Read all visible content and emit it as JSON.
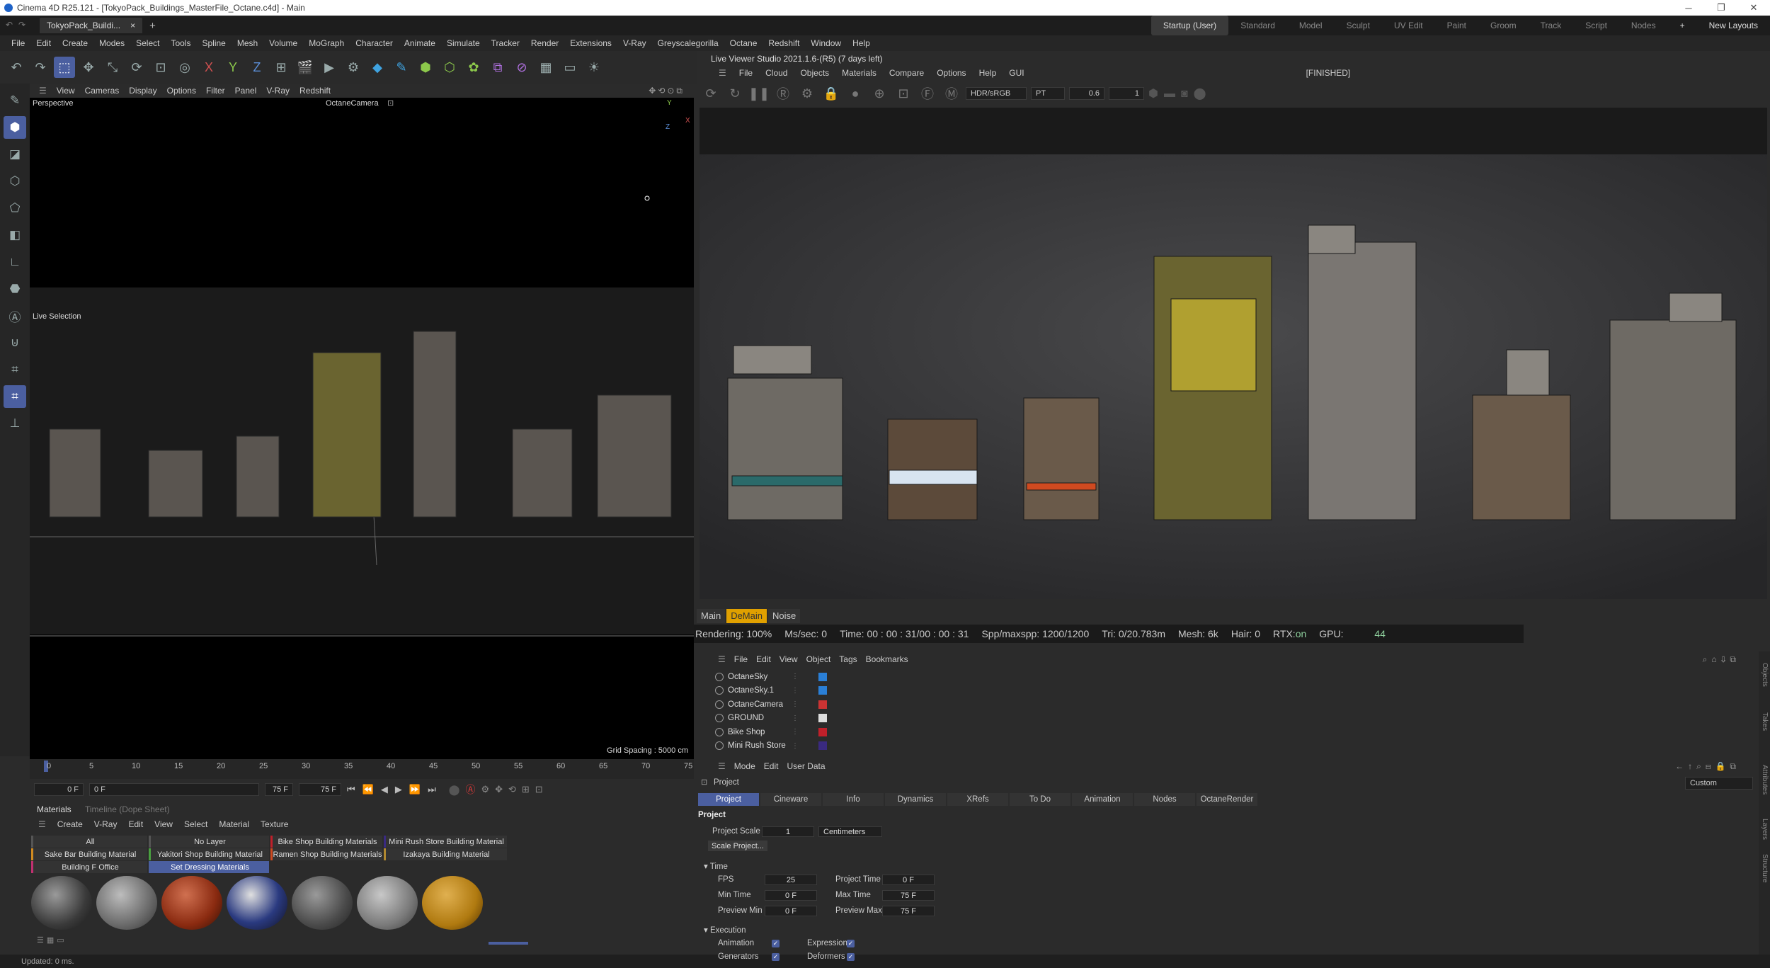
{
  "window": {
    "title": "Cinema 4D R25.121 - [TokyoPack_Buildings_MasterFile_Octane.c4d] - Main",
    "doc_tab": "TokyoPack_Buildi...",
    "close": "×",
    "add": "+"
  },
  "layouts": {
    "items": [
      "Startup (User)",
      "Standard",
      "Model",
      "Sculpt",
      "UV Edit",
      "Paint",
      "Groom",
      "Track",
      "Script",
      "Nodes"
    ],
    "add": "+",
    "new_layouts": "New Layouts"
  },
  "menubar": [
    "File",
    "Edit",
    "Create",
    "Modes",
    "Select",
    "Tools",
    "Spline",
    "Mesh",
    "Volume",
    "MoGraph",
    "Character",
    "Animate",
    "Simulate",
    "Tracker",
    "Render",
    "Extensions",
    "V-Ray",
    "Greyscalegorilla",
    "Octane",
    "Redshift",
    "Window",
    "Help"
  ],
  "viewport": {
    "menu": [
      "View",
      "Cameras",
      "Display",
      "Options",
      "Filter",
      "Panel",
      "V-Ray",
      "Redshift"
    ],
    "name": "Perspective",
    "camera": "OctaneCamera",
    "live_selection": "Live Selection",
    "grid_spacing": "Grid Spacing : 5000 cm",
    "axis_y": "Y",
    "axis_x": "X",
    "axis_z": "Z"
  },
  "timeline": {
    "ticks": [
      "0",
      "5",
      "10",
      "15",
      "20",
      "25",
      "30",
      "35",
      "40",
      "45",
      "50",
      "55",
      "60",
      "65",
      "70",
      "75"
    ],
    "start": "0 F",
    "cur": "0 F",
    "end1": "75 F",
    "end2": "75 F"
  },
  "materials": {
    "tabs": [
      "Materials",
      "Timeline (Dope Sheet)"
    ],
    "menu": [
      "Create",
      "V-Ray",
      "Edit",
      "View",
      "Select",
      "Material",
      "Texture"
    ],
    "layers": [
      "All",
      "No Layer",
      "Bike Shop Building Materials",
      "Mini Rush Store Building Material",
      "Sake Bar Building Material",
      "Yakitori Shop Building Material",
      "Ramen Shop Building Materials",
      "Izakaya Building Material",
      "Building F Office",
      "Set Dressing Materials"
    ]
  },
  "status": "Updated: 0 ms.",
  "liveviewer": {
    "title": "Live Viewer Studio 2021.1.6-(R5) (7 days left)",
    "menu": [
      "File",
      "Cloud",
      "Objects",
      "Materials",
      "Compare",
      "Options",
      "Help",
      "GUI"
    ],
    "state": "[FINISHED]",
    "colorspace": "HDR/sRGB",
    "mode": "PT",
    "value1": "0.6",
    "value2": "1"
  },
  "render_tabs": [
    "Main",
    "DeMain",
    "Noise"
  ],
  "stats": {
    "rendering": "Rendering: 100%",
    "ms": "Ms/sec: 0",
    "time": "Time: 00 : 00 : 31/00 : 00 : 31",
    "spp": "Spp/maxspp: 1200/1200",
    "tri": "Tri: 0/20.783m",
    "mesh": "Mesh: 6k",
    "hair": "Hair: 0",
    "rtx_label": "RTX:",
    "rtx": "on",
    "gpu_label": "GPU:",
    "gpu": "44"
  },
  "objects": {
    "menu": [
      "File",
      "Edit",
      "View",
      "Object",
      "Tags",
      "Bookmarks"
    ],
    "rows": [
      {
        "name": "OctaneSky",
        "tag": "#2a7fd6"
      },
      {
        "name": "OctaneSky.1",
        "tag": "#2a7fd6"
      },
      {
        "name": "OctaneCamera",
        "tag": "#cc3333"
      },
      {
        "name": "GROUND",
        "tag": "#dddddd"
      },
      {
        "name": "Bike Shop",
        "tag": "#c0202a"
      },
      {
        "name": "Mini Rush Store",
        "tag": "#3a2a80"
      }
    ]
  },
  "attributes": {
    "menu": [
      "Mode",
      "Edit",
      "User Data"
    ],
    "custom": "Custom",
    "section": "Project",
    "tabs": [
      "Project",
      "Cineware",
      "Info",
      "Dynamics",
      "XRefs",
      "To Do",
      "Animation",
      "Nodes",
      "OctaneRender"
    ],
    "heading": "Project",
    "scale_label": "Project Scale",
    "scale": "1",
    "unit": "Centimeters",
    "scale_btn": "Scale Project...",
    "time_group": "Time",
    "fps_label": "FPS",
    "fps": "25",
    "ptime_label": "Project Time",
    "ptime": "0 F",
    "min_label": "Min Time",
    "min": "0 F",
    "max_label": "Max Time",
    "max": "75 F",
    "pmin_label": "Preview Min",
    "pmin": "0 F",
    "pmax_label": "Preview Max",
    "pmax": "75 F",
    "exec_group": "Execution",
    "anim_label": "Animation",
    "expr_label": "Expression",
    "gen_label": "Generators",
    "def_label": "Deformers"
  },
  "sidebar": [
    "Objects",
    "Takes",
    "Attributes",
    "Layers",
    "Structure"
  ]
}
